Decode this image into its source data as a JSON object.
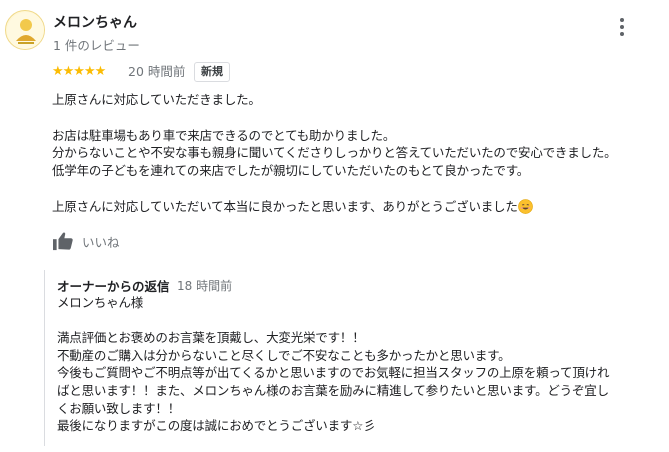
{
  "review": {
    "reviewer_name": "メロンちゃん",
    "reviewer_meta": "1 件のレビュー",
    "rating_stars": 5,
    "stars_text": "★★★★★",
    "time": "20 時間前",
    "badge": "新規",
    "paragraphs": [
      "上原さんに対応していただきました。",
      "",
      "お店は駐車場もあり車で来店できるのでとても助かりました。",
      "分からないことや不安な事も親身に聞いてくださりしっかりと答えていただいたので安心できました。",
      "低学年の子どもを連れての来店でしたが親切にしていただいたのもとて良かったです。",
      "",
      "上原さんに対応していただいて本当に良かったと思います、ありがとうございました"
    ],
    "like_label": "いいね"
  },
  "owner_reply": {
    "heading": "オーナーからの返信",
    "time": "18 時間前",
    "lines": [
      "メロンちゃん様",
      "",
      "満点評価とお褒めのお言葉を頂戴し、大変光栄です！！",
      "不動産のご購入は分からないこと尽くしでご不安なことも多かったかと思います。",
      "今後もご質問やご不明点等が出てくるかと思いますのでお気軽に担当スタッフの上原を頼って頂けれ",
      "ばと思います！！また、メロンちゃん様のお言葉を励みに精進して参りたいと思います。どうぞ宜し",
      "くお願い致します！！",
      "最後になりますがこの度は誠におめでとうございます☆彡"
    ]
  },
  "colors": {
    "star": "#fbbc04",
    "secondary_text": "#70757a",
    "primary_text": "#202124"
  },
  "icons": [
    "avatar-logo",
    "more-vert-icon",
    "star-icon",
    "smile-emoji-icon",
    "thumbs-up-icon"
  ]
}
